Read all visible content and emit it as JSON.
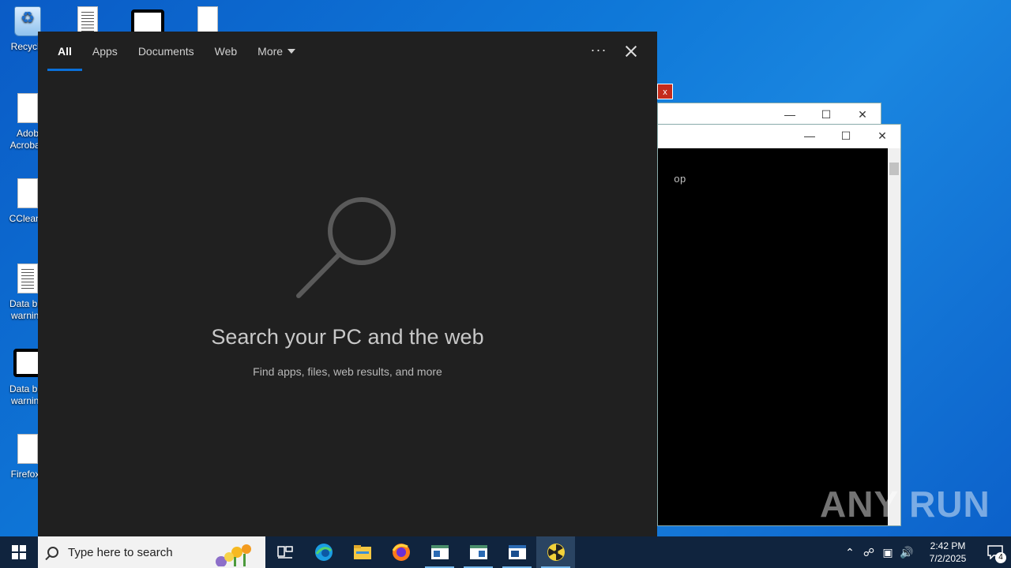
{
  "desktop": {
    "icons": [
      {
        "label": "Recycle",
        "icon": "recycle-bin-icon"
      },
      {
        "label": "Adob\nAcrobat.",
        "icon": "document-icon"
      },
      {
        "label": "CCleane",
        "icon": "document-icon"
      },
      {
        "label": "Data bre\nwarning",
        "icon": "text-document-icon"
      },
      {
        "label": "Data bre\nwarning",
        "icon": "b-logo-icon"
      },
      {
        "label": "Firefox.l",
        "icon": "document-icon"
      }
    ]
  },
  "background_windows": {
    "console_text": "op",
    "close_glyph": "x"
  },
  "search_panel": {
    "tabs": [
      {
        "label": "All",
        "active": true
      },
      {
        "label": "Apps"
      },
      {
        "label": "Documents"
      },
      {
        "label": "Web"
      },
      {
        "label": "More"
      }
    ],
    "more_options": "···",
    "title": "Search your PC and the web",
    "subtitle": "Find apps, files, web results, and more"
  },
  "watermark": "ANY RUN",
  "taskbar": {
    "search_placeholder": "Type here to search",
    "apps": [
      "task-view-icon",
      "edge-icon",
      "file-explorer-icon",
      "firefox-icon",
      "app-window-icon",
      "app-window-icon",
      "app-window-icon",
      "radiation-icon"
    ],
    "clock_time": "2:42 PM",
    "clock_date": "7/2/2025",
    "notification_count": "4"
  },
  "colors": {
    "panel_bg": "#202020",
    "accent": "#0a6fd8",
    "taskbar_bg": "#10243e"
  }
}
